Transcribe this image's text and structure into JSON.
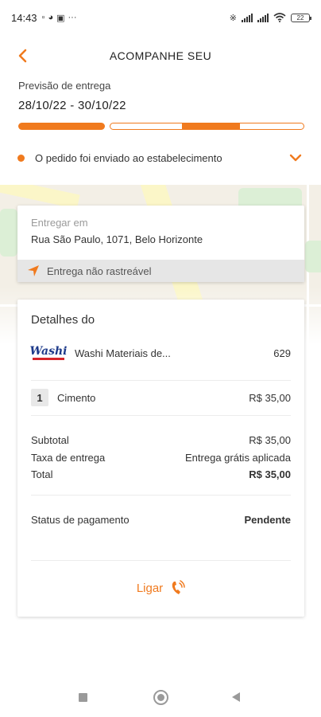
{
  "status_bar": {
    "time": "14:43",
    "more": "···",
    "battery": "22"
  },
  "header": {
    "title": "ACOMPANHE SEU"
  },
  "forecast": {
    "label": "Previsão de entrega",
    "dates": "28/10/22 - 30/10/22",
    "progress": 0.57
  },
  "order_status": {
    "text": "O pedido foi enviado ao estabelecimento"
  },
  "delivery": {
    "label": "Entregar em",
    "address": "Rua São Paulo, 1071,  Belo Horizonte",
    "tracking": "Entrega não rastreável"
  },
  "details": {
    "title": "Detalhes do",
    "store": {
      "logo_text": "Washi",
      "name": "Washi Materiais de...",
      "code": "629"
    },
    "items": [
      {
        "qty": "1",
        "name": "Cimento",
        "price": "R$ 35,00"
      }
    ],
    "summary": {
      "subtotal_label": "Subtotal",
      "subtotal_value": "R$ 35,00",
      "fee_label": "Taxa de entrega",
      "fee_value": "Entrega grátis aplicada",
      "total_label": "Total",
      "total_value": "R$ 35,00"
    },
    "payment": {
      "label": "Status de pagamento",
      "value": "Pendente"
    },
    "call_label": "Ligar"
  },
  "colors": {
    "accent": "#f07a1e",
    "text": "#333333",
    "muted": "#9a9a9a"
  }
}
